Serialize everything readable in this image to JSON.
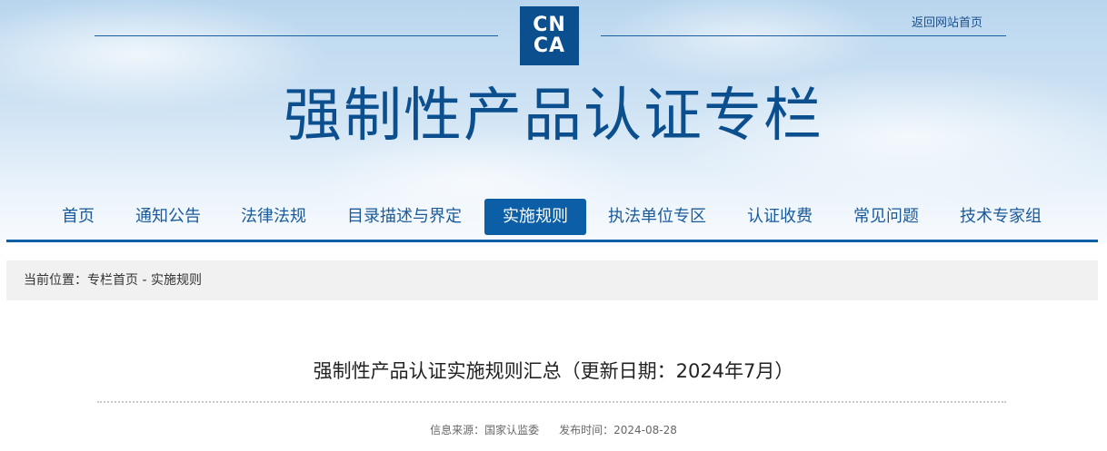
{
  "header": {
    "logo": {
      "line1": "CN",
      "line2": "CA"
    },
    "home_link": "返回网站首页",
    "site_title": "强制性产品认证专栏"
  },
  "nav": {
    "items": [
      {
        "label": "首页"
      },
      {
        "label": "通知公告"
      },
      {
        "label": "法律法规"
      },
      {
        "label": "目录描述与界定"
      },
      {
        "label": "实施规则"
      },
      {
        "label": "执法单位专区"
      },
      {
        "label": "认证收费"
      },
      {
        "label": "常见问题"
      },
      {
        "label": "技术专家组"
      }
    ],
    "active_index": 4
  },
  "breadcrumb": {
    "text": "当前位置：专栏首页 - 实施规则"
  },
  "article": {
    "title": "强制性产品认证实施规则汇总（更新日期：2024年7月）",
    "source": "信息来源：国家认监委",
    "publish_time": "发布时间：2024-08-28"
  },
  "colors": {
    "primary": "#0c5fa6",
    "title_blue": "#0c4f8f",
    "nav_text": "#1a5a9a"
  }
}
